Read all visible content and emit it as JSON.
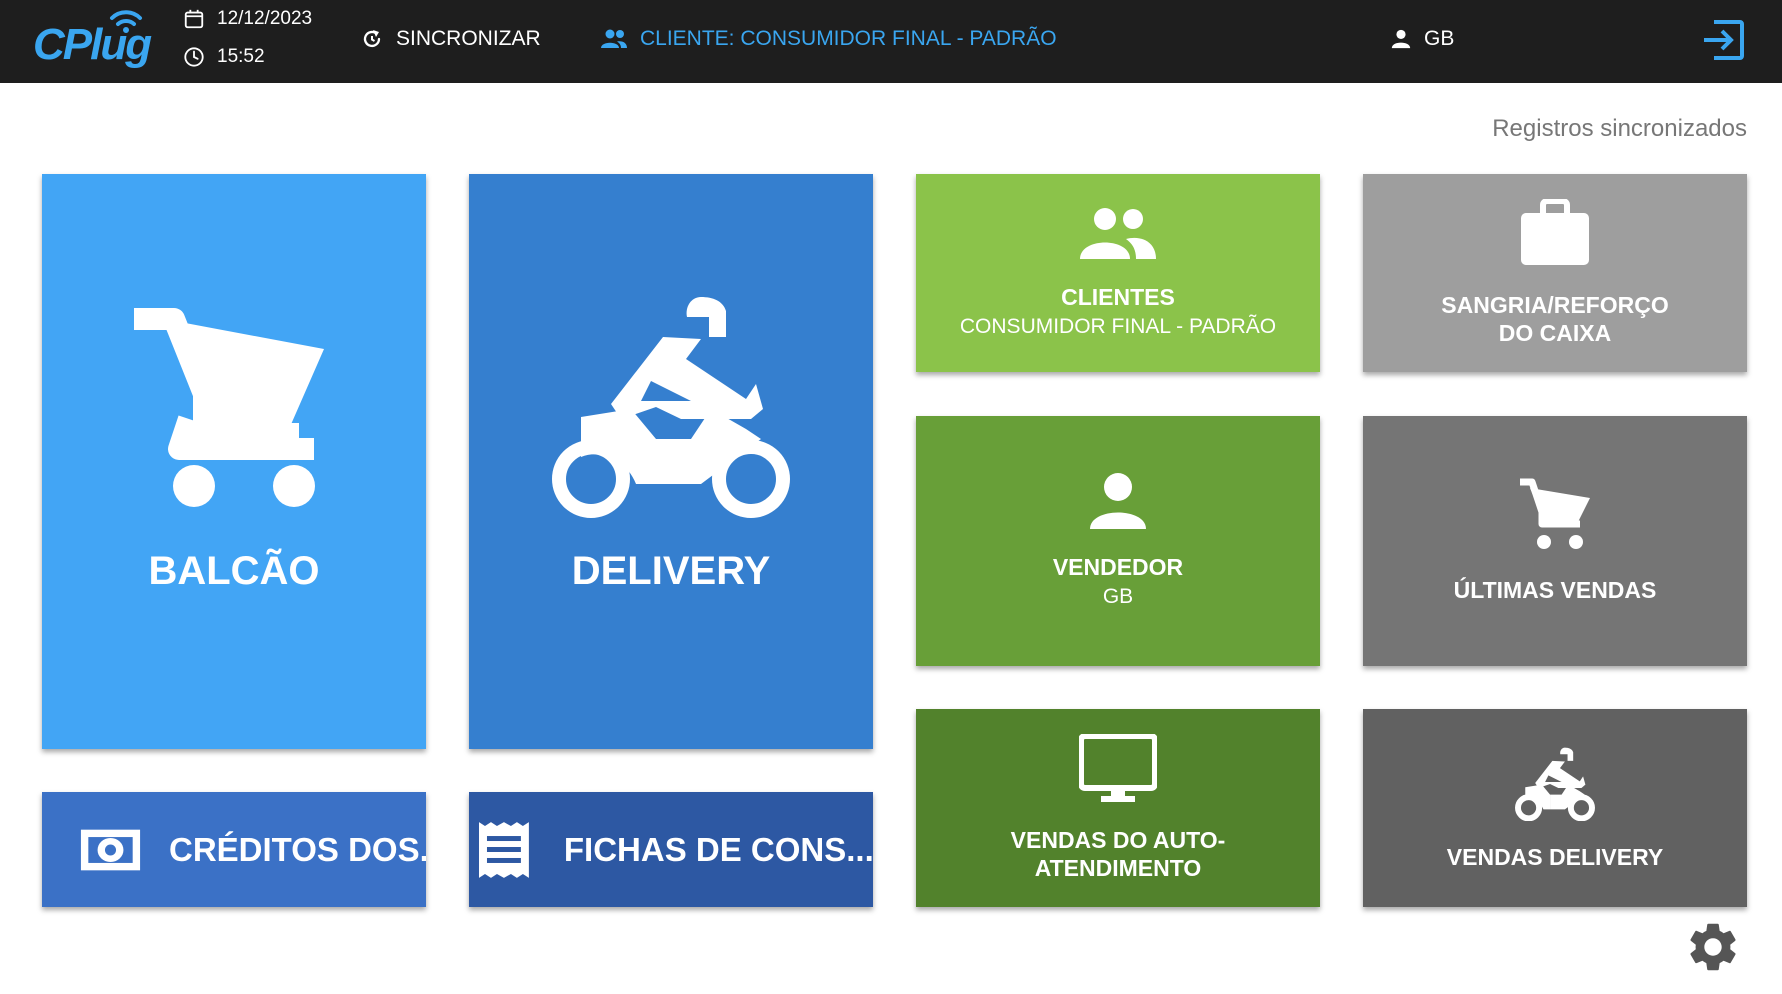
{
  "header": {
    "logo_text": "CPlug",
    "date": "12/12/2023",
    "time": "15:52",
    "sync_label": "SINCRONIZAR",
    "client_label": "CLIENTE: CONSUMIDOR FINAL - PADRÃO",
    "user_label": "GB"
  },
  "status": {
    "sync_text": "Registros sincronizados"
  },
  "tiles": {
    "balcao": {
      "title": "BALCÃO"
    },
    "delivery": {
      "title": "DELIVERY"
    },
    "creditos": {
      "title": "CRÉDITOS DOS..."
    },
    "fichas": {
      "title": "FICHAS DE CONS..."
    },
    "clientes": {
      "title": "CLIENTES",
      "subtitle": "CONSUMIDOR FINAL - PADRÃO"
    },
    "sangria": {
      "title": "SANGRIA/REFORÇO DO CAIXA"
    },
    "vendedor": {
      "title": "VENDEDOR",
      "subtitle": "GB"
    },
    "ultimas": {
      "title": "ÚLTIMAS VENDAS"
    },
    "auto": {
      "title": "VENDAS DO AUTO-ATENDIMENTO"
    },
    "vendas_delivery": {
      "title": "VENDAS DELIVERY"
    }
  },
  "colors": {
    "header_bg": "#1e1e1e",
    "accent": "#3aa6f0",
    "balcao": "#42a5f5",
    "delivery": "#357fcf",
    "creditos": "#3b71c6",
    "fichas": "#2d58a3",
    "clientes": "#8bc34a",
    "vendedor": "#689f38",
    "auto": "#52822c",
    "sangria": "#9e9e9e",
    "ultimas": "#757575",
    "vendas_delivery": "#616161"
  },
  "icons": {
    "balcao": "shopping-cart-icon",
    "delivery": "motorcycle-icon",
    "creditos": "money-icon",
    "fichas": "receipt-icon",
    "clientes": "people-icon",
    "sangria": "briefcase-icon",
    "vendedor": "person-icon",
    "ultimas": "shopping-cart-icon",
    "auto": "monitor-icon",
    "vendas_delivery": "motorcycle-icon",
    "settings": "gear-icon"
  }
}
